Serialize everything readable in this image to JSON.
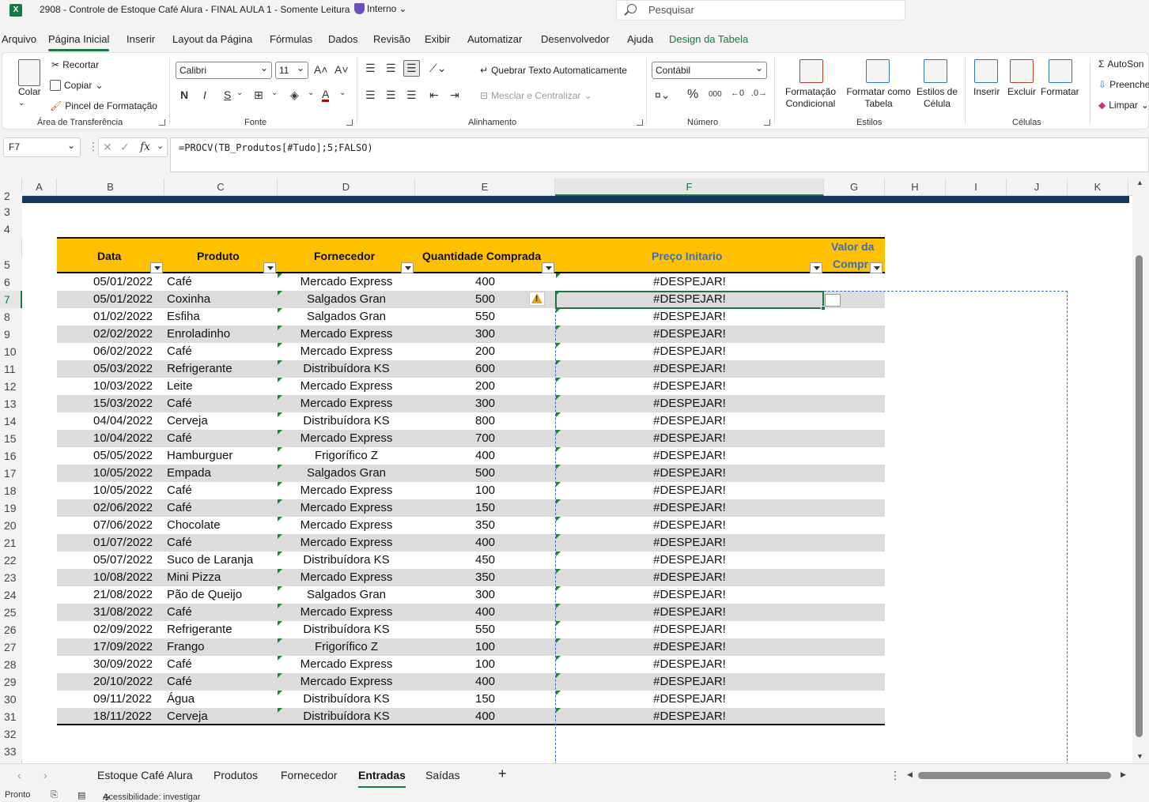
{
  "window": {
    "title": "2908 - Controle de Estoque Café Alura - FINAL AULA 1  -  Somente Leitura",
    "sensitivity": "Interno",
    "search_placeholder": "Pesquisar"
  },
  "menu_tabs": [
    "Arquivo",
    "Página Inicial",
    "Inserir",
    "Layout da Página",
    "Fórmulas",
    "Dados",
    "Revisão",
    "Exibir",
    "Automatizar",
    "Desenvolvedor",
    "Ajuda",
    "Design da Tabela"
  ],
  "ribbon": {
    "clipboard": {
      "paste": "Colar",
      "cut": "Recortar",
      "copy": "Copiar",
      "format_painter": "Pincel de Formatação",
      "label": "Área de Transferência"
    },
    "font": {
      "name": "Calibri",
      "size": "11",
      "bold": "N",
      "italic": "I",
      "underline": "S",
      "label": "Fonte"
    },
    "alignment": {
      "wrap": "Quebrar Texto Automaticamente",
      "merge": "Mesclar e Centralizar",
      "label": "Alinhamento"
    },
    "number": {
      "format": "Contábil",
      "percent": "%",
      "thousands": "000",
      "label": "Número"
    },
    "styles": {
      "conditional": "Formatação Condicional",
      "as_table": "Formatar como Tabela",
      "cell_styles": "Estilos de Célula",
      "label": "Estilos"
    },
    "cells": {
      "insert": "Inserir",
      "delete": "Excluir",
      "format": "Formatar",
      "label": "Células"
    },
    "editing": {
      "autosum": "AutoSon",
      "fill": "Preenche",
      "clear": "Limpar"
    }
  },
  "formula_bar": {
    "name_box": "F7",
    "fx": "fx",
    "formula": "=PROCV(TB_Produtos[#Tudo];5;FALSO)"
  },
  "columns": [
    "A",
    "B",
    "C",
    "D",
    "E",
    "F",
    "G",
    "H",
    "I",
    "J",
    "K"
  ],
  "table": {
    "headers": {
      "data": "Data",
      "produto": "Produto",
      "fornecedor": "Fornecedor",
      "quantidade": "Quantidade Comprada",
      "preco": "Preço Initario",
      "valor_line1": "Valor da",
      "valor_line2": "Compr"
    },
    "rows": [
      {
        "n": "6",
        "data": "05/01/2022",
        "produto": "Café",
        "fornecedor": "Mercado Express",
        "qtd": "400",
        "preco": "#DESPEJAR!"
      },
      {
        "n": "7",
        "data": "05/01/2022",
        "produto": "Coxinha",
        "fornecedor": "Salgados Gran",
        "qtd": "500",
        "preco": "#DESPEJAR!"
      },
      {
        "n": "8",
        "data": "01/02/2022",
        "produto": "Esfiha",
        "fornecedor": "Salgados Gran",
        "qtd": "550",
        "preco": "#DESPEJAR!"
      },
      {
        "n": "9",
        "data": "02/02/2022",
        "produto": "Enroladinho",
        "fornecedor": "Mercado Express",
        "qtd": "300",
        "preco": "#DESPEJAR!"
      },
      {
        "n": "10",
        "data": "06/02/2022",
        "produto": "Café",
        "fornecedor": "Mercado Express",
        "qtd": "200",
        "preco": "#DESPEJAR!"
      },
      {
        "n": "11",
        "data": "05/03/2022",
        "produto": "Refrigerante",
        "fornecedor": "Distribuídora KS",
        "qtd": "600",
        "preco": "#DESPEJAR!"
      },
      {
        "n": "12",
        "data": "10/03/2022",
        "produto": "Leite",
        "fornecedor": "Mercado Express",
        "qtd": "200",
        "preco": "#DESPEJAR!"
      },
      {
        "n": "13",
        "data": "15/03/2022",
        "produto": "Café",
        "fornecedor": "Mercado Express",
        "qtd": "300",
        "preco": "#DESPEJAR!"
      },
      {
        "n": "14",
        "data": "04/04/2022",
        "produto": "Cerveja",
        "fornecedor": "Distribuídora KS",
        "qtd": "800",
        "preco": "#DESPEJAR!"
      },
      {
        "n": "15",
        "data": "10/04/2022",
        "produto": "Café",
        "fornecedor": "Mercado Express",
        "qtd": "700",
        "preco": "#DESPEJAR!"
      },
      {
        "n": "16",
        "data": "05/05/2022",
        "produto": "Hamburguer",
        "fornecedor": "Frigorífico Z",
        "qtd": "400",
        "preco": "#DESPEJAR!"
      },
      {
        "n": "17",
        "data": "10/05/2022",
        "produto": "Empada",
        "fornecedor": "Salgados Gran",
        "qtd": "500",
        "preco": "#DESPEJAR!"
      },
      {
        "n": "18",
        "data": "10/05/2022",
        "produto": "Café",
        "fornecedor": "Mercado Express",
        "qtd": "100",
        "preco": "#DESPEJAR!"
      },
      {
        "n": "19",
        "data": "02/06/2022",
        "produto": "Café",
        "fornecedor": "Mercado Express",
        "qtd": "150",
        "preco": "#DESPEJAR!"
      },
      {
        "n": "20",
        "data": "07/06/2022",
        "produto": "Chocolate",
        "fornecedor": "Mercado Express",
        "qtd": "350",
        "preco": "#DESPEJAR!"
      },
      {
        "n": "21",
        "data": "01/07/2022",
        "produto": "Café",
        "fornecedor": "Mercado Express",
        "qtd": "400",
        "preco": "#DESPEJAR!"
      },
      {
        "n": "22",
        "data": "05/07/2022",
        "produto": "Suco de Laranja",
        "fornecedor": "Distribuídora KS",
        "qtd": "450",
        "preco": "#DESPEJAR!"
      },
      {
        "n": "23",
        "data": "10/08/2022",
        "produto": "Mini Pizza",
        "fornecedor": "Mercado Express",
        "qtd": "350",
        "preco": "#DESPEJAR!"
      },
      {
        "n": "24",
        "data": "21/08/2022",
        "produto": "Pão de Queijo",
        "fornecedor": "Salgados Gran",
        "qtd": "300",
        "preco": "#DESPEJAR!"
      },
      {
        "n": "25",
        "data": "31/08/2022",
        "produto": "Café",
        "fornecedor": "Mercado Express",
        "qtd": "400",
        "preco": "#DESPEJAR!"
      },
      {
        "n": "26",
        "data": "02/09/2022",
        "produto": "Refrigerante",
        "fornecedor": "Distribuídora KS",
        "qtd": "550",
        "preco": "#DESPEJAR!"
      },
      {
        "n": "27",
        "data": "17/09/2022",
        "produto": "Frango",
        "fornecedor": "Frigorífico Z",
        "qtd": "100",
        "preco": "#DESPEJAR!"
      },
      {
        "n": "28",
        "data": "30/09/2022",
        "produto": "Café",
        "fornecedor": "Mercado Express",
        "qtd": "100",
        "preco": "#DESPEJAR!"
      },
      {
        "n": "29",
        "data": "20/10/2022",
        "produto": "Café",
        "fornecedor": "Mercado Express",
        "qtd": "400",
        "preco": "#DESPEJAR!"
      },
      {
        "n": "30",
        "data": "09/11/2022",
        "produto": "Água",
        "fornecedor": "Distribuídora KS",
        "qtd": "150",
        "preco": "#DESPEJAR!"
      },
      {
        "n": "31",
        "data": "18/11/2022",
        "produto": "Cerveja",
        "fornecedor": "Distribuídora KS",
        "qtd": "400",
        "preco": "#DESPEJAR!"
      }
    ]
  },
  "row_numbers_top": [
    "2",
    "3",
    "4",
    "5"
  ],
  "row_numbers_bottom": [
    "32",
    "33"
  ],
  "sheets": [
    "Estoque Café Alura",
    "Produtos",
    "Fornecedor",
    "Entradas",
    "Saídas"
  ],
  "active_sheet": "Entradas",
  "status": {
    "ready": "Pronto",
    "accessibility": "Acessibilidade: investigar"
  },
  "colors": {
    "accent": "#107c41",
    "table_header": "#ffc000",
    "band": "#dcdcdc",
    "title_band": "#17375e"
  }
}
